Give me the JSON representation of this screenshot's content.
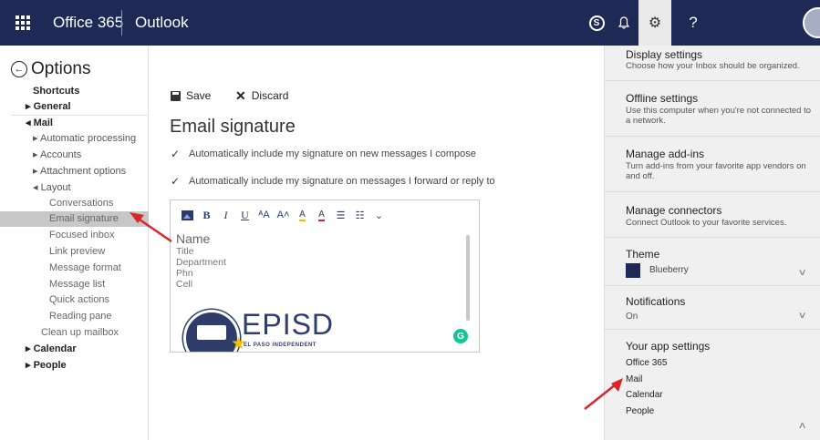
{
  "topbar": {
    "brand": "Office 365",
    "app_name": "Outlook",
    "skype_glyph": "S",
    "bell_glyph": "🔔",
    "gear_glyph": "⚙",
    "help_glyph": "?"
  },
  "leftnav": {
    "title": "Options",
    "items": [
      {
        "label": "Shortcuts"
      },
      {
        "label": "General"
      },
      {
        "label": "Mail"
      },
      {
        "label": "Automatic processing"
      },
      {
        "label": "Accounts"
      },
      {
        "label": "Attachment options"
      },
      {
        "label": "Layout"
      },
      {
        "label": "Conversations"
      },
      {
        "label": "Email signature"
      },
      {
        "label": "Focused inbox"
      },
      {
        "label": "Link preview"
      },
      {
        "label": "Message format"
      },
      {
        "label": "Message list"
      },
      {
        "label": "Quick actions"
      },
      {
        "label": "Reading pane"
      },
      {
        "label": "Clean up mailbox"
      },
      {
        "label": "Calendar"
      },
      {
        "label": "People"
      }
    ]
  },
  "main": {
    "save_label": "Save",
    "discard_label": "Discard",
    "title": "Email signature",
    "check_new": "Automatically include my signature on new messages I compose",
    "check_forward": "Automatically include my signature on messages I forward or reply to",
    "signature": {
      "name": "Name",
      "lines": [
        "Title",
        "Department",
        "Phn",
        "Cell"
      ],
      "logo_text": "EPISD",
      "logo_sub": "EL PASO INDEPENDENT"
    },
    "grammarly_glyph": "G"
  },
  "rightpanel": {
    "display_settings": {
      "title": "Display settings",
      "desc": "Choose how your Inbox should be organized."
    },
    "offline_settings": {
      "title": "Offline settings",
      "desc": "Use this computer when you're not connected to a network."
    },
    "manage_addins": {
      "title": "Manage add-ins",
      "desc": "Turn add-ins from your favorite app vendors on and off."
    },
    "manage_connectors": {
      "title": "Manage connectors",
      "desc": "Connect Outlook to your favorite services."
    },
    "theme": {
      "title": "Theme",
      "value": "Blueberry",
      "swatch_color": "#1e2a55"
    },
    "notifications": {
      "title": "Notifications",
      "value": "On"
    },
    "app_settings": {
      "title": "Your app settings",
      "links": [
        "Office 365",
        "Mail",
        "Calendar",
        "People"
      ]
    }
  },
  "colors": {
    "topbar": "#1e2a55",
    "selected_nav": "#c7c7c7",
    "panel_bg": "#f0f0f0",
    "annotation_arrow": "#d9262b"
  }
}
